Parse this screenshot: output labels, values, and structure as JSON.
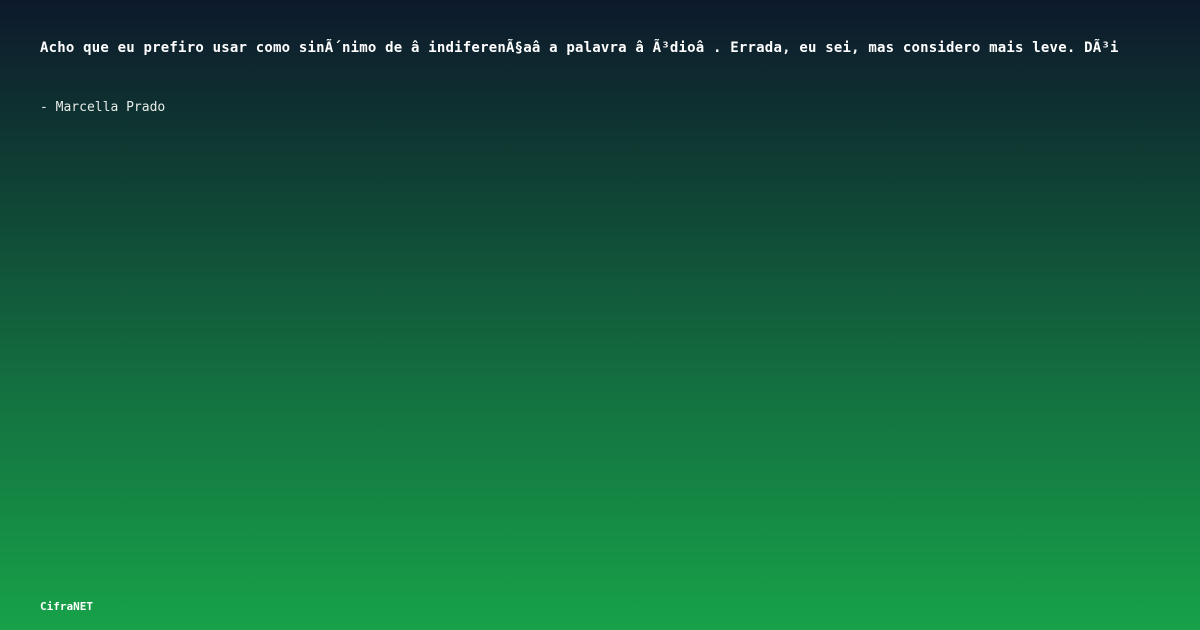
{
  "quote": {
    "text": "Acho que eu prefiro usar como sinÃ´nimo de â  indiferenÃ§aâ   a palavra â  Ã³dioâ  . Errada, eu sei, mas considero mais leve. DÃ³i"
  },
  "author": {
    "text": "- Marcella Prado"
  },
  "brand": {
    "name": "CifraNET"
  }
}
